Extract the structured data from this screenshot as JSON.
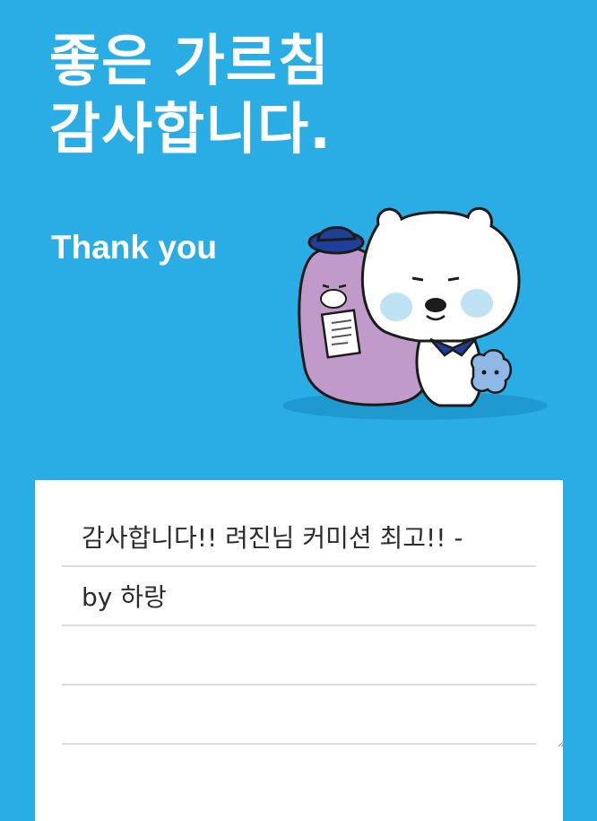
{
  "headline": {
    "line1": "좋은 가르침",
    "line2": "감사합니다."
  },
  "subheadline": "Thank you",
  "illustration": {
    "icon": "bear-characters-icon",
    "colors": {
      "background": "#29ade4",
      "bear": "#ffffff",
      "cheek": "#bfe2f4",
      "purple_character": "#c09ac9",
      "hat": "#1f3f99",
      "small_creature": "#8fb8e6",
      "shadow": "#1f9ad0"
    }
  },
  "message": {
    "lines": [
      "감사합니다!! 려진님 커미션 최고!! -",
      "by 하랑",
      "",
      ""
    ]
  }
}
